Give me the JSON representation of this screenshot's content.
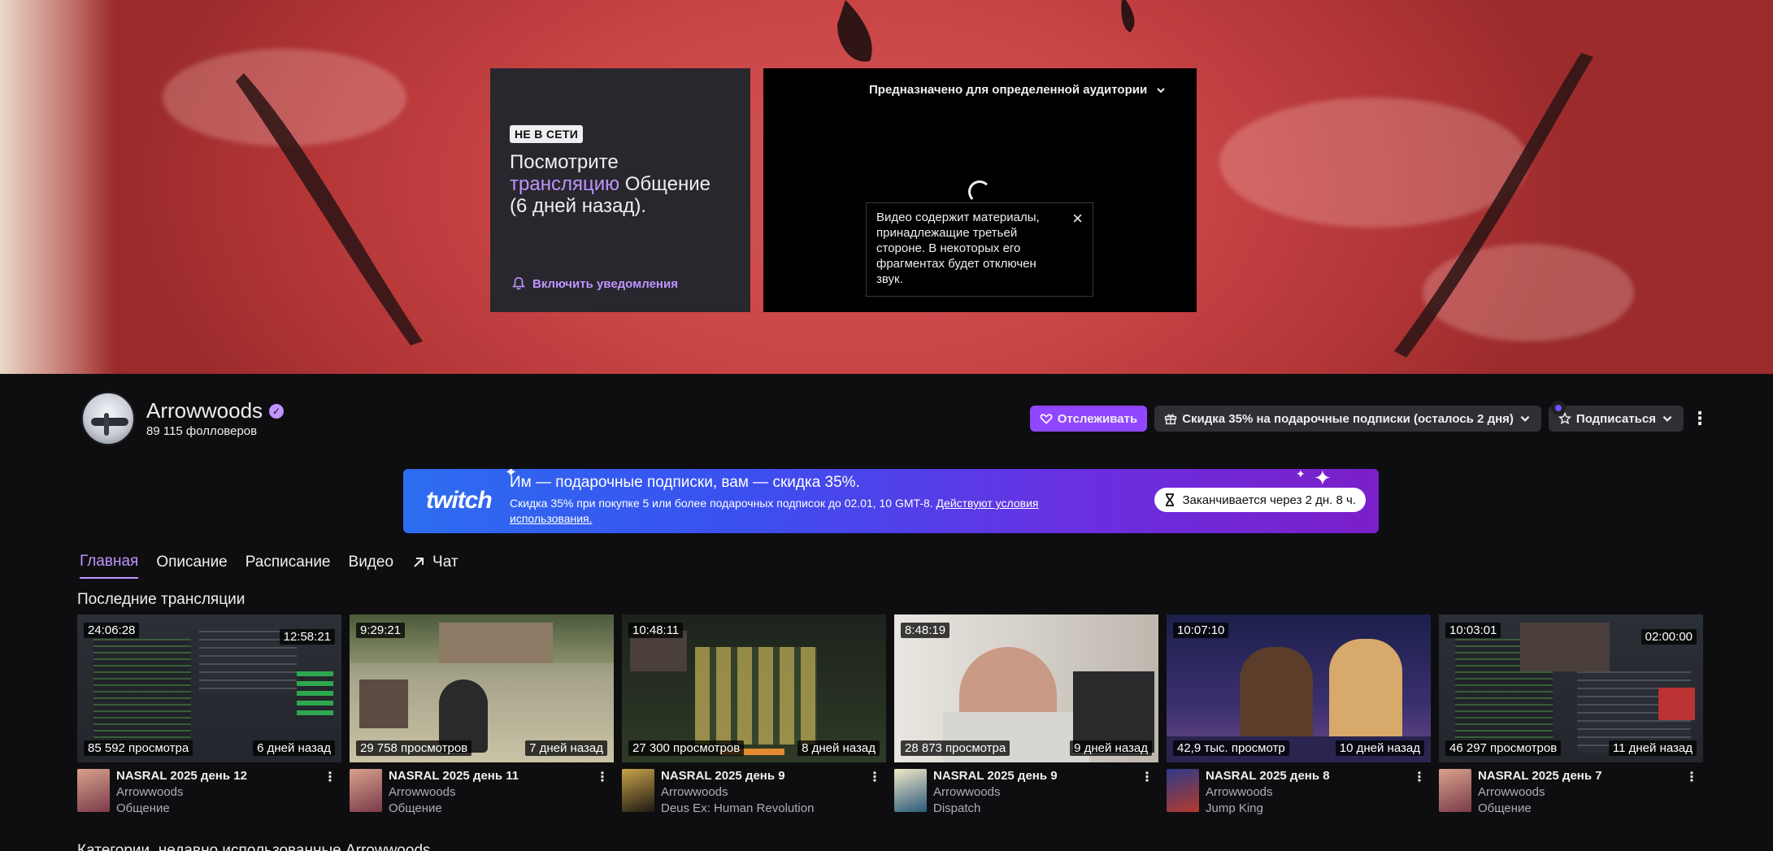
{
  "banner": {
    "offline_badge": "НЕ В СЕТИ",
    "offline_pre": "Посмотрите",
    "offline_link": "трансляцию",
    "offline_category": "Общение",
    "offline_when": "(6 дней назад).",
    "notify_label": "Включить уведомления",
    "player_audience": "Предназначено для определенной аудитории",
    "muted_notice": "Видео содержит материалы, принадлежащие третьей стороне. В некоторых его фрагментах будет отключен звук."
  },
  "channel": {
    "name": "Arrowwoods",
    "followers": "89 115 фолловеров",
    "follow_label": "Отслеживать",
    "gift_label": "Скидка 35% на подарочные подписки (осталось 2 дня)",
    "subscribe_label": "Подписаться"
  },
  "promo": {
    "logo": "twitch",
    "title": "Им — подарочные подписки, вам — скидка 35%.",
    "subtitle": "Скидка 35% при покупке 5 или более подарочных подписок до 02.01, 10 GMT-8.",
    "terms": "Действуют условия использования.",
    "timer": "Заканчивается через 2 дн. 8 ч."
  },
  "tabs": [
    "Главная",
    "Описание",
    "Расписание",
    "Видео",
    "Чат"
  ],
  "section_title": "Последние трансляции",
  "videos": [
    {
      "duration": "24:06:28",
      "corner": "12:58:21",
      "views": "85 592 просмотра",
      "age": "6 дней назад",
      "title": "NASRAL 2025 день 12",
      "channel": "Arrowwoods",
      "category": "Общение"
    },
    {
      "duration": "9:29:21",
      "corner": "",
      "views": "29 758 просмотров",
      "age": "7 дней назад",
      "title": "NASRAL 2025 день 11",
      "channel": "Arrowwoods",
      "category": "Общение"
    },
    {
      "duration": "10:48:11",
      "corner": "",
      "views": "27 300 просмотров",
      "age": "8 дней назад",
      "title": "NASRAL 2025 день 9",
      "channel": "Arrowwoods",
      "category": "Deus Ex: Human Revolution"
    },
    {
      "duration": "8:48:19",
      "corner": "",
      "views": "28 873 просмотра",
      "age": "9 дней назад",
      "title": "NASRAL 2025 день 9",
      "channel": "Arrowwoods",
      "category": "Dispatch"
    },
    {
      "duration": "10:07:10",
      "corner": "",
      "views": "42,9 тыс. просмотр",
      "age": "10 дней назад",
      "title": "NASRAL 2025 день 8",
      "channel": "Arrowwoods",
      "category": "Jump King"
    },
    {
      "duration": "10:03:01",
      "corner": "02:00:00",
      "views": "46 297 просмотров",
      "age": "11 дней назад",
      "title": "NASRAL 2025 день 7",
      "channel": "Arrowwoods",
      "category": "Общение"
    }
  ],
  "next_section_title": "Категории, недавно использованные Arrowwoods",
  "icons": {
    "bell": "bell-icon",
    "heart": "heart-icon",
    "gift": "gift-icon",
    "star": "star-icon",
    "hourglass": "hourglass-icon",
    "external": "arrow-up-right-icon",
    "more": "more-vertical-icon",
    "close": "close-icon",
    "verified": "verified-badge-icon"
  },
  "colors": {
    "accent": "#bf94ff",
    "primary_button": "#9147ff",
    "page_bg": "#0e0e10"
  }
}
